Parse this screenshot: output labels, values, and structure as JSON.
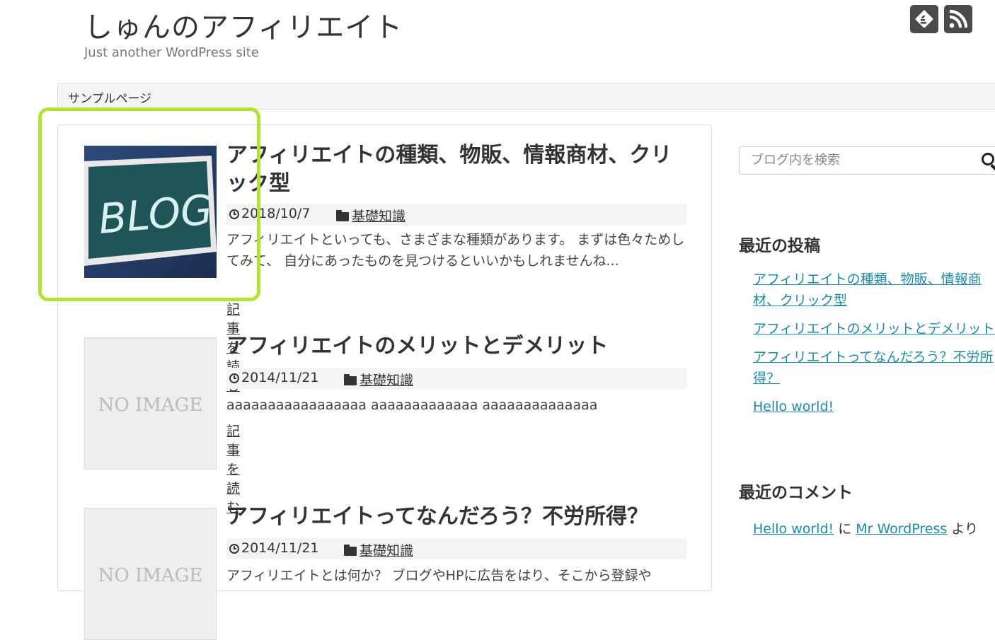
{
  "header": {
    "site_title": "しゅんのアフィリエイト",
    "tagline": "Just another WordPress site",
    "icons": [
      "feedly-icon",
      "rss-icon"
    ]
  },
  "nav": {
    "items": [
      "サンプルページ"
    ]
  },
  "posts": [
    {
      "title": "アフィリエイトの種類、物販、情報商材、クリック型",
      "date": "2018/10/7",
      "category": "基礎知識",
      "excerpt": "アフィリエイトといっても、さまざまな種類があります。 まずは色々ためしてみて、 自分にあったものを見つけるといいかもしれませんね...",
      "read_more": "記事を読む",
      "thumbnail_text": "BLOG"
    },
    {
      "title": "アフィリエイトのメリットとデメリット",
      "date": "2014/11/21",
      "category": "基礎知識",
      "excerpt": "aaaaaaaaaaaaaaaaa aaaaaaaaaaaaa aaaaaaaaaaaaaa",
      "read_more": "記事を読む",
      "thumbnail_text": "NO IMAGE"
    },
    {
      "title": "アフィリエイトってなんだろう？不労所得？",
      "date": "2014/11/21",
      "category": "基礎知識",
      "excerpt": "アフィリエイトとは何か？ ブログやHPに広告をはり、そこから登録や",
      "thumbnail_text": "NO IMAGE"
    }
  ],
  "sidebar": {
    "search_placeholder": "ブログ内を検索",
    "recent_posts_title": "最近の投稿",
    "recent_posts": [
      "アフィリエイトの種類、物販、情報商材、クリック型",
      "アフィリエイトのメリットとデメリット",
      "アフィリエイトってなんだろう？不労所得？",
      "Hello world!"
    ],
    "recent_comments_title": "最近のコメント",
    "recent_comment": {
      "post": "Hello world!",
      "on": "に",
      "author": "Mr WordPress",
      "suffix": "より"
    }
  },
  "colors": {
    "highlight": "#b3e234",
    "link": "#1f8aa7",
    "icon_bg": "#4a4a4a"
  }
}
